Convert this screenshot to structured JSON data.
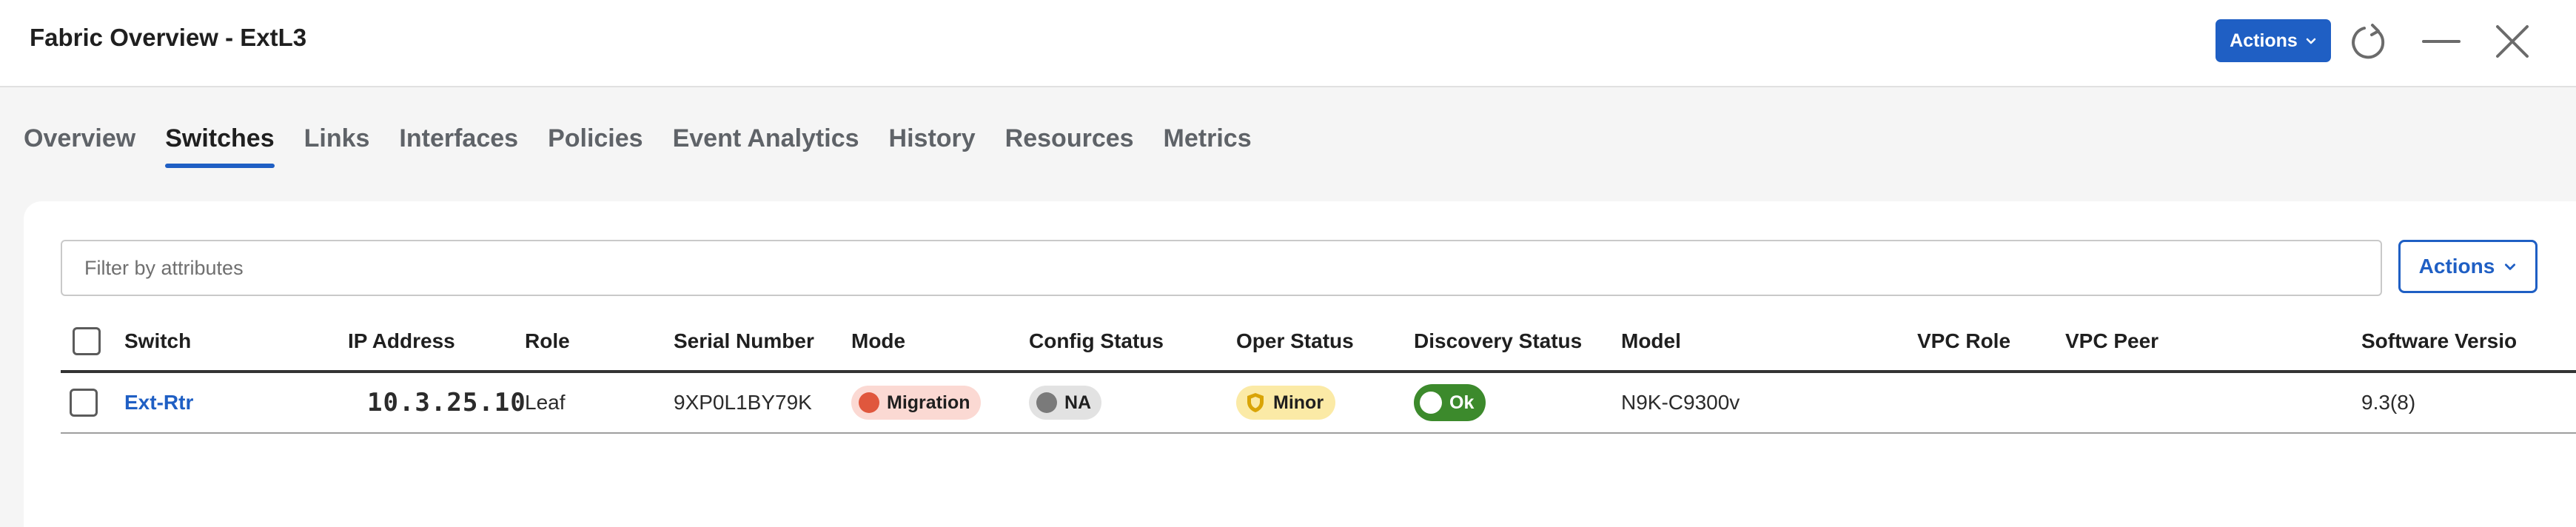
{
  "header": {
    "title": "Fabric Overview - ExtL3",
    "actions_label": "Actions"
  },
  "tabs": [
    {
      "label": "Overview"
    },
    {
      "label": "Switches",
      "active": true
    },
    {
      "label": "Links"
    },
    {
      "label": "Interfaces"
    },
    {
      "label": "Policies"
    },
    {
      "label": "Event Analytics"
    },
    {
      "label": "History"
    },
    {
      "label": "Resources"
    },
    {
      "label": "Metrics"
    }
  ],
  "filter": {
    "placeholder": "Filter by attributes",
    "value": ""
  },
  "card_actions_label": "Actions",
  "table": {
    "columns": [
      "Switch",
      "IP Address",
      "Role",
      "Serial Number",
      "Mode",
      "Config Status",
      "Oper Status",
      "Discovery Status",
      "Model",
      "VPC Role",
      "VPC Peer",
      "Software Versio"
    ],
    "rows": [
      {
        "switch": "Ext-Rtr",
        "ip": "10.3.25.10",
        "role": "Leaf",
        "serial": "9XP0L1BY79K",
        "mode": "Migration",
        "config_status": "NA",
        "oper_status": "Minor",
        "discovery_status": "Ok",
        "model": "N9K-C9300v",
        "vpc_role": "",
        "vpc_peer": "",
        "software_version": "9.3(8)"
      }
    ]
  },
  "colors": {
    "accent": "#1f5fc4",
    "ip_text": "#e31b1b",
    "migration": "#e0573d",
    "minor": "#fbeaa6",
    "ok": "#3c8a2c"
  },
  "icons": {
    "refresh": "refresh-icon",
    "minimize": "minimize-icon",
    "close": "close-icon",
    "chevron": "chevron-down-icon",
    "shield": "shield-icon"
  }
}
